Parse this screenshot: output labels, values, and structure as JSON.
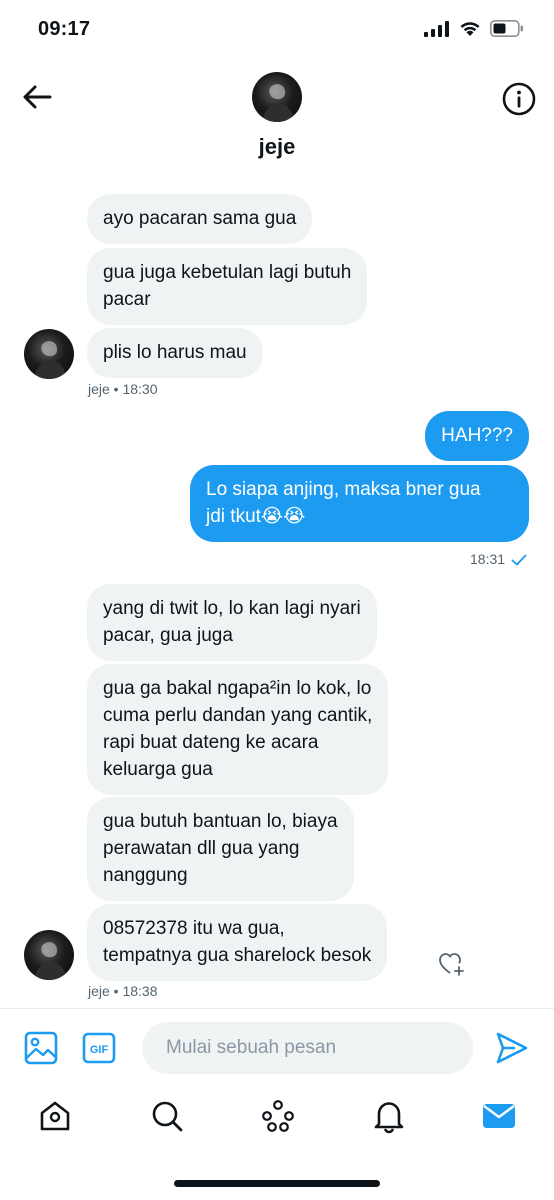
{
  "status_bar": {
    "time": "09:17"
  },
  "header": {
    "name": "jeje"
  },
  "messages": [
    {
      "text": "ayo pacaran sama gua"
    },
    {
      "text": "gua juga kebetulan lagi butuh\npacar"
    },
    {
      "text": "plis lo harus mau"
    },
    {
      "text": "HAH???"
    },
    {
      "text": "Lo siapa anjing, maksa bner gua\njdi tkut😭😭"
    },
    {
      "text": "yang di twit lo, lo kan lagi nyari\npacar, gua juga"
    },
    {
      "text": "gua ga bakal ngapa²in lo kok, lo\ncuma perlu dandan yang cantik,\nrapi buat dateng ke acara\nkeluarga gua"
    },
    {
      "text": "gua butuh bantuan lo, biaya\nperawatan dll gua yang\nnanggung"
    },
    {
      "text": "08572378 itu wa gua,\ntempatnya gua sharelock besok"
    }
  ],
  "meta": {
    "group1": "jeje • 18:30",
    "outgoing_time": "18:31",
    "group3": "jeje • 18:38"
  },
  "composer": {
    "placeholder": "Mulai sebuah pesan"
  },
  "colors": {
    "accent": "#1d9bf0",
    "incoming_bubble": "#eff3f4",
    "muted": "#536471"
  },
  "icons": [
    "back-arrow-icon",
    "info-icon",
    "image-icon",
    "gif-icon",
    "send-icon",
    "home-icon",
    "search-icon",
    "spaces-icon",
    "notifications-icon",
    "messages-icon",
    "heart-add-icon"
  ]
}
